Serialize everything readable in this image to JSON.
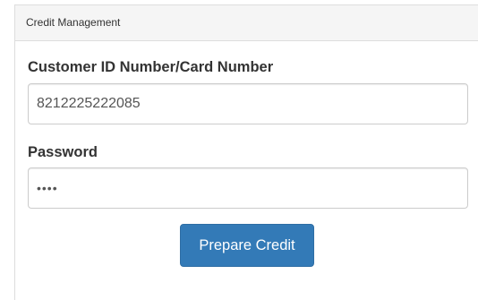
{
  "panel": {
    "heading": "Credit Management"
  },
  "form": {
    "customer_id_label": "Customer ID Number/Card Number",
    "customer_id_value": "8212225222085",
    "password_label": "Password",
    "password_value": "••••",
    "submit_label": "Prepare Credit"
  },
  "colors": {
    "primary_button": "#337ab7",
    "panel_heading_bg": "#f5f5f5",
    "border": "#dddddd"
  }
}
